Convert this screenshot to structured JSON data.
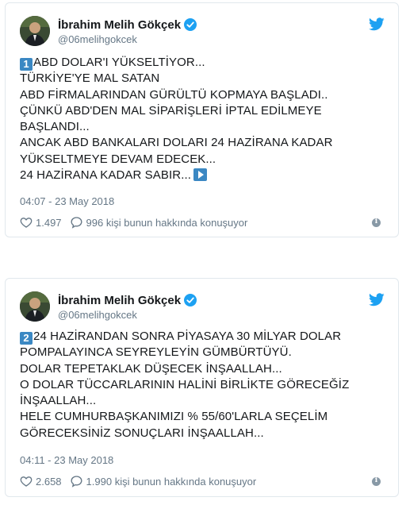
{
  "colors": {
    "accent": "#1da1f2",
    "keycap": "#3b88c3",
    "muted": "#657786",
    "border": "#e1e8ed"
  },
  "tweets": [
    {
      "author_name": "İbrahim Melih Gökçek",
      "handle": "@06melihgokcek",
      "keycap": "1",
      "lines": [
        "ABD DOLAR'I YÜKSELTİYOR...",
        "TÜRKİYE'YE MAL SATAN",
        "ABD FİRMALARINDAN GÜRÜLTÜ KOPMAYA BAŞLADI..",
        "ÇÜNKÜ ABD'DEN MAL SİPARİŞLERİ İPTAL EDİLMEYE",
        "BAŞLANDI...",
        "ANCAK ABD BANKALARI DOLARI 24 HAZİRANA KADAR",
        "YÜKSELTMEYE DEVAM EDECEK...",
        "24 HAZİRANA KADAR SABIR..."
      ],
      "end_icon": "play-button-icon",
      "timestamp": "04:07 - 23 May 2018",
      "likes": "1.497",
      "replies_text": "996 kişi bunun hakkında konuşuyor"
    },
    {
      "author_name": "İbrahim Melih Gökçek",
      "handle": "@06melihgokcek",
      "keycap": "2",
      "lines": [
        "24 HAZİRANDAN SONRA PİYASAYA 30 MİLYAR DOLAR",
        "POMPALAYINCA SEYREYLEYİN GÜMBÜRTÜYÜ.",
        "DOLAR TEPETAKLAK DÜŞECEK İNŞAALLAH...",
        "O DOLAR TÜCCARLARININ HALİNİ BİRLİKTE GÖRECEĞİZ",
        "İNŞAALLAH...",
        "HELE CUMHURBAŞKANIMIZI % 55/60'LARLA SEÇELİM",
        "GÖRECEKSİNİZ SONUÇLARI İNŞAALLAH..."
      ],
      "timestamp": "04:11 - 23 May 2018",
      "likes": "2.658",
      "replies_text": "1.990 kişi bunun hakkında konuşuyor"
    }
  ]
}
